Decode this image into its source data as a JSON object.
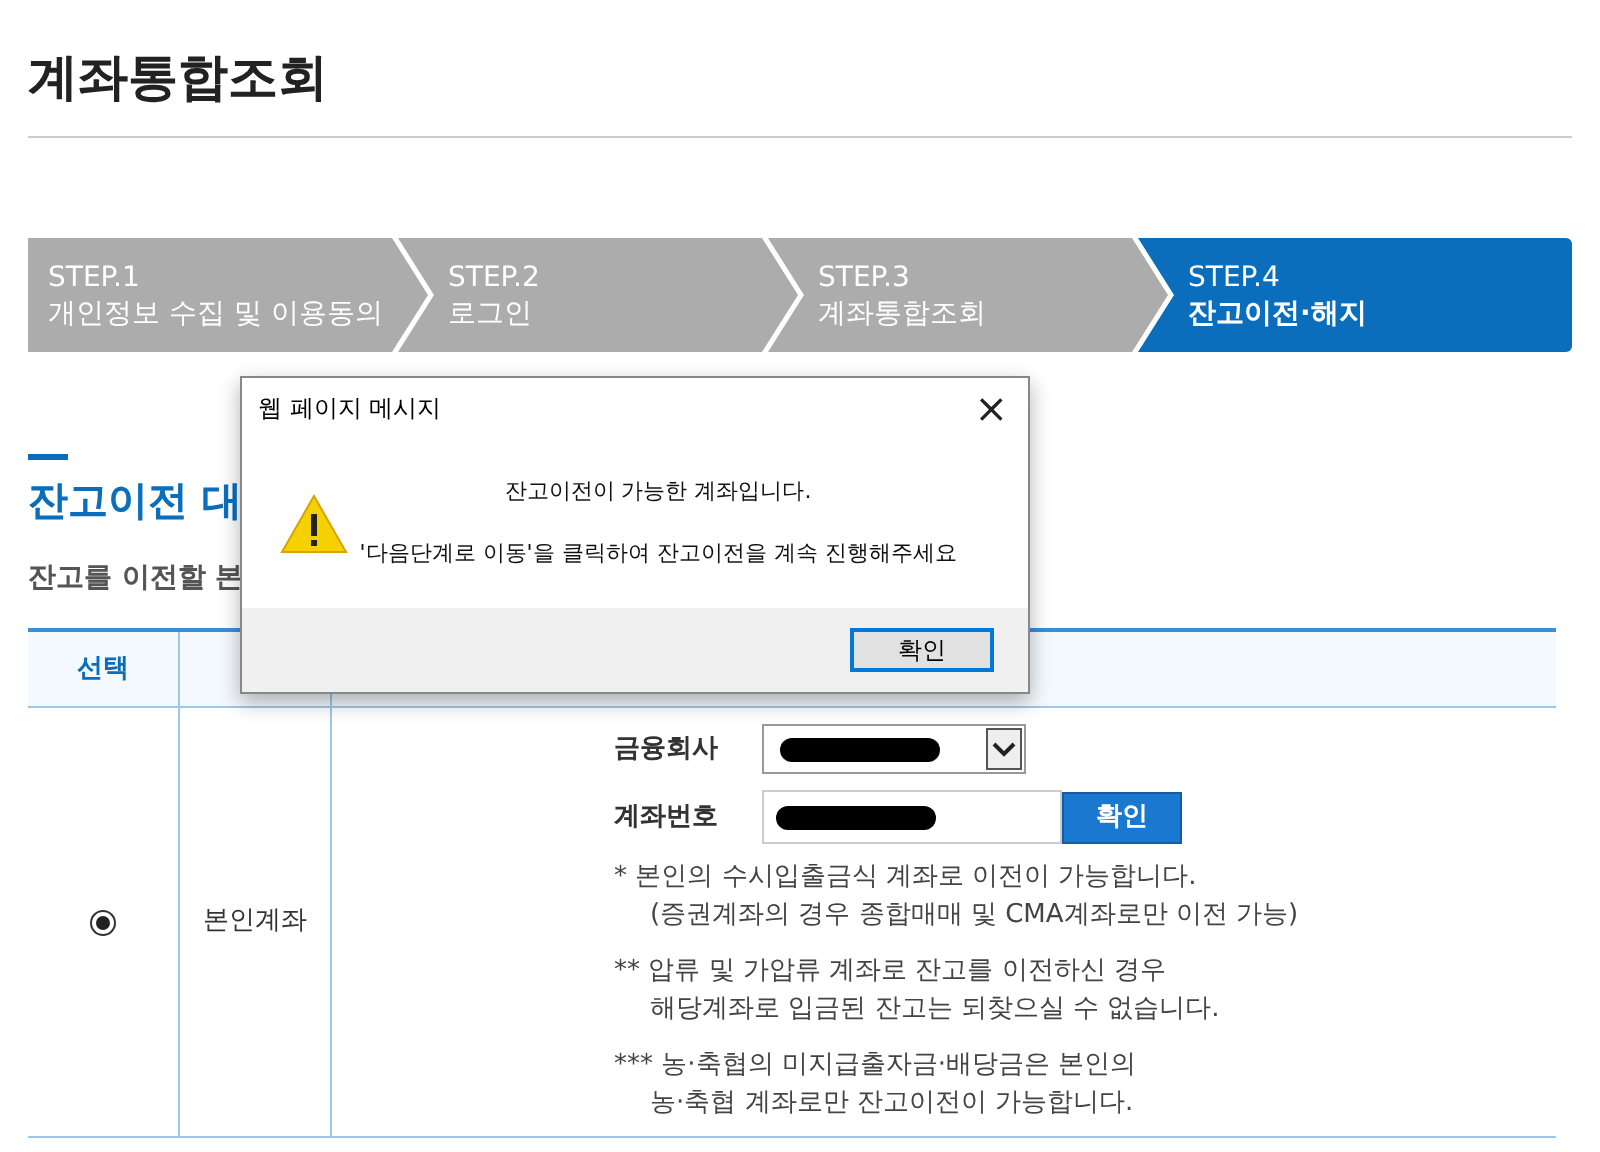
{
  "page_title": "계좌통합조회",
  "steps": [
    {
      "number": "STEP.1",
      "label": "개인정보 수집 및 이용동의",
      "selected": false
    },
    {
      "number": "STEP.2",
      "label": "로그인",
      "selected": false
    },
    {
      "number": "STEP.3",
      "label": "계좌통합조회",
      "selected": false
    },
    {
      "number": "STEP.4",
      "label": "잔고이전·해지",
      "selected": true
    }
  ],
  "section_heading": "잔고이전 대",
  "section_subtitle": "잔고를 이전할 본",
  "table": {
    "columns": [
      "선택"
    ],
    "row": {
      "selected": true,
      "type": "본인계좌",
      "fields": [
        {
          "label": "금융회사",
          "kind": "select",
          "redacted": true
        },
        {
          "label": "계좌번호",
          "kind": "input",
          "redacted": true,
          "button": "확인"
        }
      ],
      "notes": [
        [
          "* 본인의 수시입출금식 계좌로 이전이 가능합니다.",
          "(증권계좌의 경우 종합매매 및 CMA계좌로만 이전 가능)"
        ],
        [
          "** 압류 및 가압류 계좌로 잔고를 이전하신 경우",
          "해당계좌로 입금된 잔고는 되찾으실 수 없습니다."
        ],
        [
          "*** 농·축협의 미지급출자금·배당금은 본인의",
          "농·축협 계좌로만 잔고이전이 가능합니다."
        ]
      ]
    }
  },
  "dialog": {
    "title": "웹 페이지 메시지",
    "close": "×",
    "messages": [
      "잔고이전이 가능한 계좌입니다.",
      "'다음단계로 이동'을 클릭하여 잔고이전을 계속 진행해주세요"
    ],
    "button": "확인"
  }
}
